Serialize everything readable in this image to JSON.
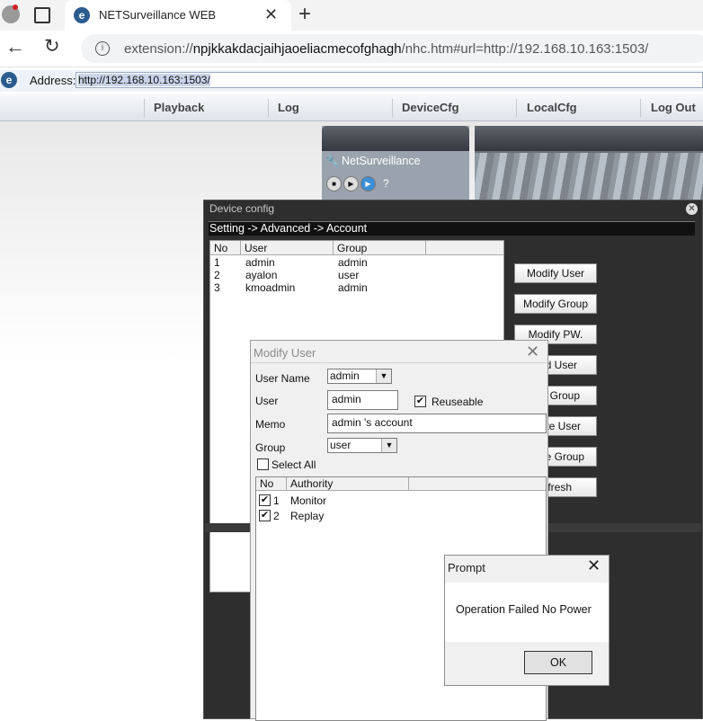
{
  "browser": {
    "tab_title": "NETSurveillance WEB",
    "url_prefix": "extension://",
    "url_host": "npjkkakdacjaihjaoeliacmecofghagh",
    "url_path": "/nhc.htm#url=http://192.168.10.163:1503/"
  },
  "address_bar": {
    "label": "Address:",
    "value": "http://192.168.10.163:1503/"
  },
  "menu": {
    "items": [
      "Playback",
      "Log",
      "DeviceCfg",
      "LocalCfg",
      "Log Out"
    ]
  },
  "side_panel": {
    "title": "NetSurveillance",
    "help": "?"
  },
  "device_config": {
    "title": "Device config",
    "breadcrumb": "Setting -> Advanced -> Account",
    "columns": [
      "No",
      "User",
      "Group"
    ],
    "rows": [
      {
        "no": "1",
        "user": "admin",
        "group": "admin"
      },
      {
        "no": "2",
        "user": "ayalon",
        "group": "user"
      },
      {
        "no": "3",
        "user": "kmoadmin",
        "group": "admin"
      }
    ],
    "buttons": [
      "Modify User",
      "Modify Group",
      "Modify PW.",
      "d User",
      "d Group",
      "ete User",
      "te Group",
      "efresh"
    ]
  },
  "modify_user": {
    "title": "Modify User",
    "username_label": "User Name",
    "username_value": "admin",
    "user_label": "User",
    "user_value": "admin",
    "reuseable_label": "Reuseable",
    "memo_label": "Memo",
    "memo_value": "admin 's account",
    "group_label": "Group",
    "group_value": "user",
    "select_all_label": "Select All",
    "columns": [
      "No",
      "Authority"
    ],
    "authorities": [
      {
        "no": "1",
        "name": "Monitor",
        "checked": true
      },
      {
        "no": "2",
        "name": "Replay",
        "checked": true
      }
    ]
  },
  "prompt": {
    "title": "Prompt",
    "message": "Operation Failed No Power",
    "ok": "OK"
  }
}
